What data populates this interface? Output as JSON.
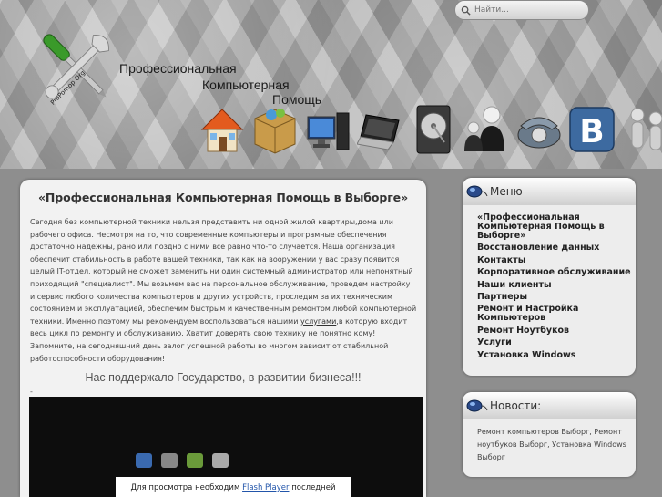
{
  "header": {
    "title_lines": [
      "Профессиональная",
      "Компьютерная",
      "Помощь"
    ],
    "logo_text": "ProPomop.Org",
    "search": {
      "placeholder": "Найти..."
    }
  },
  "nav_icons": [
    "home-icon",
    "box-icon",
    "computer-icon",
    "laptop-icon",
    "hard-drive-icon",
    "user-icon",
    "phone-icon",
    "vk-icon",
    "people-icon"
  ],
  "main": {
    "title": "«Профессиональная Компьютерная Помощь в Выборге»",
    "body_part1": "Сегодня без компьютерной техники нельзя представить ни одной жилой квартиры,дома или рабочего офиса. Несмотря на то, что современные компьютеры и програмные обеспечения достаточно надежны, рано или поздно с ними все равно что-то случается. Наша организация обеспечит стабильность в работе вашей техники, так как на вооружении у вас сразу появится целый IT-отдел, который не сможет заменить ни один системный администратор или непонятный приходящий \"специалист\". Мы возьмем вас на персональное обслуживание, проведем настройку и сервис любого количества компьютеров и других устройств, проследим за их техническим состоянием и эксплуатацией, обеспечим быстрым и качественным ремонтом любой компьютерной техники. Именно поэтому мы рекомендуем воспользоваться нашими ",
    "body_link": "услугами",
    "body_part2": ",в которую входит весь цикл по ремонту и обслуживанию. Хватит доверять свою технику не понятно кому! Запомните, на сегодняшний день залог успешной работы во многом зависит от стабильной работоспособности оборудования!",
    "slogan": "Нас поддержало Государство, в развитии бизнеса!!!",
    "dash": "-",
    "flash_prefix": "Для просмотра необходим ",
    "flash_link": "Flash Player",
    "flash_suffix": " последней"
  },
  "sidebar": {
    "menu_title": "Меню",
    "menu_items": [
      "«Профессиональная Компьютерная Помощь в Выборге»",
      "Восстановление данных",
      "Контакты",
      "Корпоративное обслуживание",
      "Наши клиенты",
      "Партнеры",
      "Ремонт и Настройка Компьютеров",
      "Ремонт Ноутбуков",
      "Услуги",
      "Установка Windows"
    ],
    "news_title": "Новости:",
    "news_text": "Ремонт компьютеров Выборг, Ремонт ноутбуков Выборг, Установка Windows Выборг"
  },
  "colors": {
    "header_bg": "#a0a0a0",
    "panel_bg": "#f2f2f2",
    "link": "#2255aa",
    "vk_blue": "#3d6aa0"
  }
}
